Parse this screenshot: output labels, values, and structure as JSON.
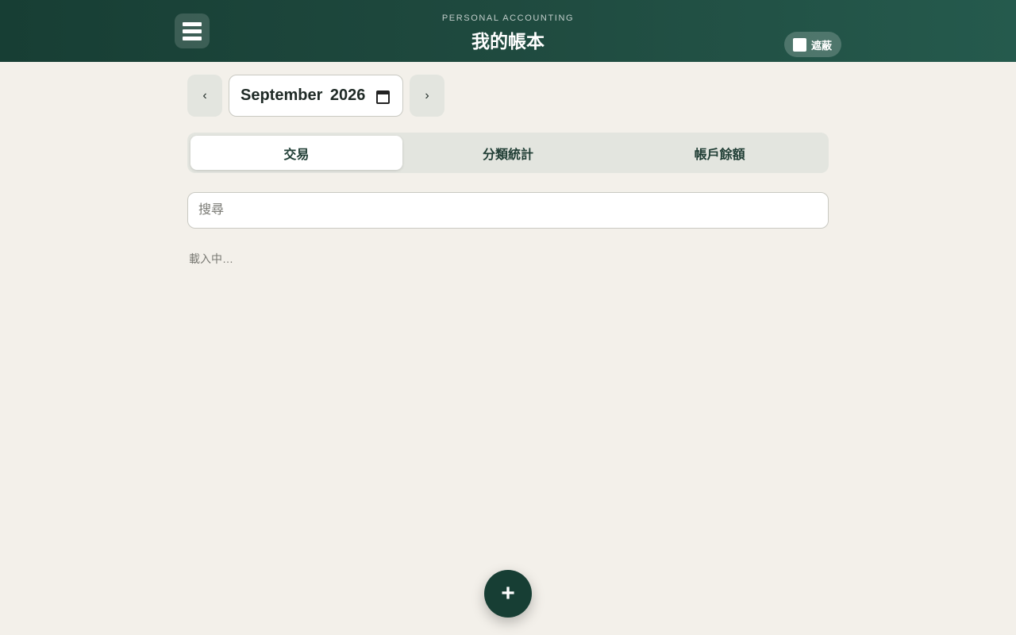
{
  "header": {
    "subtitle": "PERSONAL ACCOUNTING",
    "title": "我的帳本",
    "menu_icon": "hamburger-menu-icon",
    "mask_toggle": {
      "label": "遮蔽",
      "checked": false
    }
  },
  "month_nav": {
    "prev_label": "‹",
    "next_label": "›",
    "selected_month": "September 2026",
    "calendar_icon": "calendar-icon"
  },
  "tabs": [
    {
      "label": "交易",
      "active": true
    },
    {
      "label": "分類統計",
      "active": false
    },
    {
      "label": "帳戶餘額",
      "active": false
    }
  ],
  "search": {
    "placeholder": "搜尋",
    "value": ""
  },
  "status": {
    "loading_text": "載入中…"
  },
  "fab": {
    "label": "+",
    "icon": "add-icon"
  },
  "colors": {
    "header_dark": "#173e34",
    "header_light": "#255a4d",
    "background": "#f3f0ea",
    "tab_bar": "#e3e5df",
    "fab": "#173e34"
  }
}
